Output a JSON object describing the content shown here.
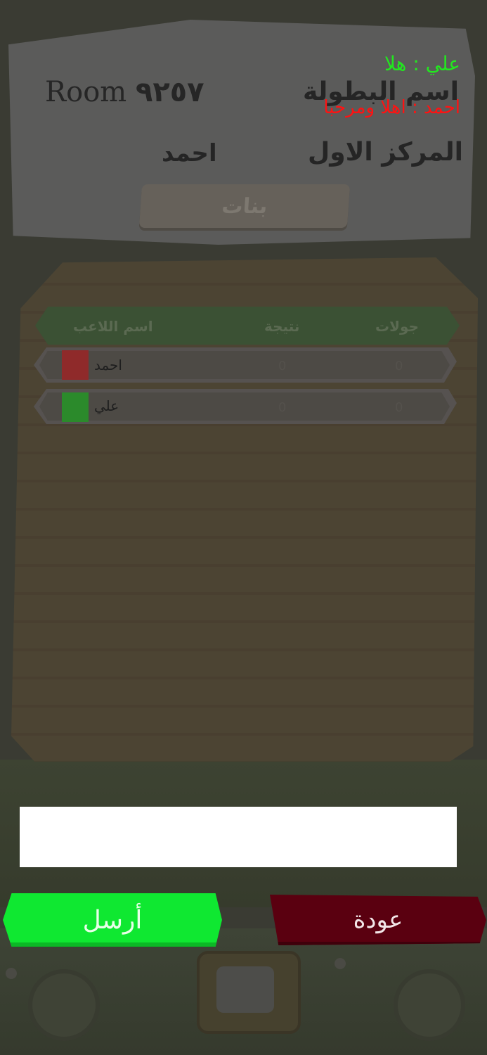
{
  "header": {
    "room_word": "Room",
    "room_number": "٩٢٥٧",
    "tournament_name_label": "اسم البطولة",
    "place_label": "المركز الاول",
    "player_name": "احمد",
    "category_button_label": "بنات"
  },
  "chat": {
    "messages": [
      {
        "text": "علي : هلا",
        "color": "#22e81f"
      },
      {
        "text": "احمد : اهلا ومرحبا",
        "color": "#ff1212"
      }
    ],
    "input_value": ""
  },
  "table": {
    "headers": {
      "player": "اسم اللاعب",
      "score": "نتيجة",
      "rounds": "جولات"
    },
    "rows": [
      {
        "name": "احمد",
        "score": "0",
        "rounds": "0",
        "color": "#8f2a2a"
      },
      {
        "name": "علي",
        "score": "0",
        "rounds": "0",
        "color": "#2b8a2b"
      }
    ]
  },
  "buttons": {
    "send_label": "أرسل",
    "back_label": "عودة"
  }
}
